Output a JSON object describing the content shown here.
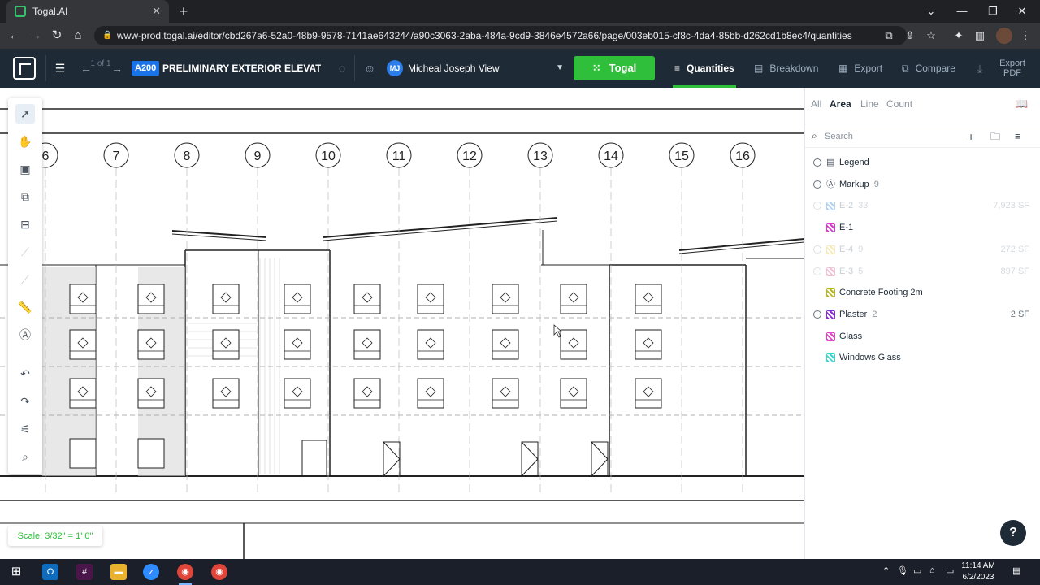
{
  "browser": {
    "tab_title": "Togal.AI",
    "url": "www-prod.togal.ai/editor/cbd267a6-52a0-48b9-9578-7141ae643244/a90c3063-2aba-484a-9cd9-3846e4572a66/page/003eb015-cf8c-4da4-85bb-d262cd1b8ec4/quantities"
  },
  "header": {
    "page_nav": "1 of 1",
    "sheet_code": "A200",
    "sheet_title": "PRELIMINARY EXTERIOR ELEVATIO...",
    "view_initials": "MJ",
    "view_name": "Micheal Joseph View",
    "togal_button": "Togal",
    "tabs": [
      {
        "label": "Quantities",
        "icon": "quantities-icon"
      },
      {
        "label": "Breakdown",
        "icon": "breakdown-icon"
      },
      {
        "label": "Export",
        "icon": "export-icon"
      },
      {
        "label": "Compare",
        "icon": "compare-icon"
      }
    ],
    "export_pdf": "Export PDF"
  },
  "canvas": {
    "scale_label": "Scale: 3/32\" = 1' 0\"",
    "gridlines": [
      "6",
      "7",
      "8",
      "9",
      "10",
      "11",
      "12",
      "13",
      "14",
      "15",
      "16"
    ]
  },
  "panel": {
    "filters": [
      "All",
      "Area",
      "Line",
      "Count"
    ],
    "active_filter": "Area",
    "search_placeholder": "Search",
    "items": [
      {
        "name": "Legend",
        "count": "",
        "value": "",
        "color": "",
        "group": true,
        "checked": true,
        "faded": false
      },
      {
        "name": "Markup",
        "count": "9",
        "value": "",
        "color": "",
        "group": true,
        "checked": true,
        "faded": false
      },
      {
        "name": "E-2",
        "count": "33",
        "value": "7,923 SF",
        "color": "#2a7de1",
        "group": false,
        "checked": false,
        "faded": true
      },
      {
        "name": "E-1",
        "count": "",
        "value": "",
        "color": "#d63ad0",
        "group": false,
        "checked": false,
        "faded": false
      },
      {
        "name": "E-4",
        "count": "9",
        "value": "272 SF",
        "color": "#e3c53a",
        "group": false,
        "checked": false,
        "faded": true
      },
      {
        "name": "E-3",
        "count": "5",
        "value": "897 SF",
        "color": "#e0508a",
        "group": false,
        "checked": false,
        "faded": true
      },
      {
        "name": "Concrete Footing 2m",
        "count": "",
        "value": "",
        "color": "#b8b81e",
        "group": false,
        "checked": false,
        "faded": false
      },
      {
        "name": "Plaster",
        "count": "2",
        "value": "2 SF",
        "color": "#8a2bd6",
        "group": false,
        "checked": true,
        "faded": false
      },
      {
        "name": "Glass",
        "count": "",
        "value": "",
        "color": "#e046c9",
        "group": false,
        "checked": false,
        "faded": false
      },
      {
        "name": "Windows Glass",
        "count": "",
        "value": "",
        "color": "#38d6cf",
        "group": false,
        "checked": false,
        "faded": false
      }
    ]
  },
  "taskbar": {
    "time": "11:14 AM",
    "date": "6/2/2023"
  }
}
